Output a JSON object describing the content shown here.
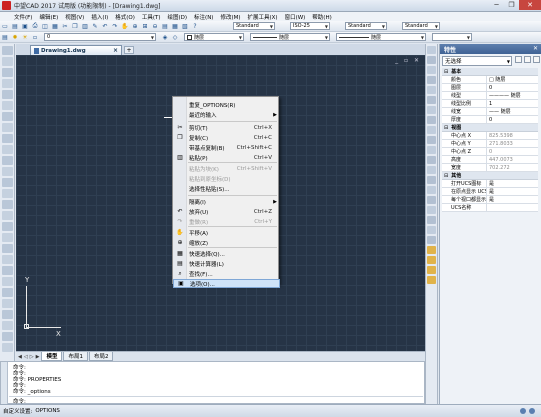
{
  "window": {
    "title": "中望CAD 2017 试用版 (功能限制) - [Drawing1.dwg]",
    "controls": [
      "─",
      "❐",
      "✕"
    ]
  },
  "menubar": [
    "文件(F)",
    "编辑(E)",
    "视图(V)",
    "插入(I)",
    "格式(O)",
    "工具(T)",
    "绘图(D)",
    "标注(N)",
    "修改(M)",
    "扩展工具(X)",
    "窗口(W)",
    "帮助(H)"
  ],
  "toolbar": {
    "textstyle": "Standard",
    "dimstyle": "ISO-25",
    "tablestyle": "Standard",
    "mleaderstyle": "Standard",
    "layer": "0",
    "color": "随层",
    "linetype": "随层",
    "lineweight": "随层"
  },
  "drawing": {
    "tab_label": "Drawing1.dwg",
    "ucs_x": "X",
    "ucs_y": "Y",
    "canvas_controls": "_ ▫ ✕"
  },
  "layout_tabs": [
    "模型",
    "布局1",
    "布局2"
  ],
  "context_menu": {
    "items": [
      {
        "label": "重复_OPTIONS(R)",
        "shortcut": "",
        "submenu": false,
        "disabled": false,
        "icon": ""
      },
      {
        "label": "最近的输入",
        "shortcut": "",
        "submenu": true,
        "disabled": false,
        "icon": ""
      },
      {
        "label": "剪切(T)",
        "shortcut": "Ctrl+X",
        "submenu": false,
        "disabled": false,
        "icon": "scissors-icon"
      },
      {
        "label": "复制(C)",
        "shortcut": "Ctrl+C",
        "submenu": false,
        "disabled": false,
        "icon": "copy-icon"
      },
      {
        "label": "带基点复制(B)",
        "shortcut": "Ctrl+Shift+C",
        "submenu": false,
        "disabled": false,
        "icon": ""
      },
      {
        "label": "粘贴(P)",
        "shortcut": "Ctrl+V",
        "submenu": false,
        "disabled": false,
        "icon": "paste-icon"
      },
      {
        "label": "粘贴为块(K)",
        "shortcut": "Ctrl+Shift+V",
        "submenu": false,
        "disabled": true,
        "icon": ""
      },
      {
        "label": "粘贴到原坐标(D)",
        "shortcut": "",
        "submenu": false,
        "disabled": true,
        "icon": ""
      },
      {
        "label": "选择性粘贴(S)...",
        "shortcut": "",
        "submenu": false,
        "disabled": false,
        "icon": ""
      },
      {
        "label": "隔离(I)",
        "shortcut": "",
        "submenu": true,
        "disabled": false,
        "icon": ""
      },
      {
        "label": "放弃(U)",
        "shortcut": "Ctrl+Z",
        "submenu": false,
        "disabled": false,
        "icon": "undo-icon"
      },
      {
        "label": "重做(R)",
        "shortcut": "Ctrl+Y",
        "submenu": false,
        "disabled": true,
        "icon": "redo-icon"
      },
      {
        "label": "平移(A)",
        "shortcut": "",
        "submenu": false,
        "disabled": false,
        "icon": "pan-icon"
      },
      {
        "label": "缩放(Z)",
        "shortcut": "",
        "submenu": false,
        "disabled": false,
        "icon": "zoom-icon"
      },
      {
        "label": "快速选择(Q)...",
        "shortcut": "",
        "submenu": false,
        "disabled": false,
        "icon": "quick-select-icon"
      },
      {
        "label": "快速计算器(L)",
        "shortcut": "",
        "submenu": false,
        "disabled": false,
        "icon": "calculator-icon"
      },
      {
        "label": "查找(F)...",
        "shortcut": "",
        "submenu": false,
        "disabled": false,
        "icon": "find-icon"
      },
      {
        "label": "选项(O)...",
        "shortcut": "",
        "submenu": false,
        "disabled": false,
        "icon": "options-icon"
      }
    ]
  },
  "command": {
    "history": [
      "命令:",
      "命令:",
      "命令: PROPERTIES",
      "命令:",
      "命令: _options"
    ],
    "prompt": "命令:"
  },
  "status": {
    "current_setting_label": "自定义设置:",
    "current_setting_value": "OPTIONS"
  },
  "properties": {
    "title": "特性",
    "selection": "无选择",
    "categories": [
      {
        "name": "基本",
        "rows": [
          {
            "key": "颜色",
            "value": "□ 随层",
            "readonly": false
          },
          {
            "key": "图层",
            "value": "0",
            "readonly": false
          },
          {
            "key": "线型",
            "value": "———— 随层",
            "readonly": false
          },
          {
            "key": "线型比例",
            "value": "1",
            "readonly": false
          },
          {
            "key": "线宽",
            "value": "—— 随层",
            "readonly": false
          },
          {
            "key": "厚度",
            "value": "0",
            "readonly": false
          }
        ]
      },
      {
        "name": "视图",
        "rows": [
          {
            "key": "中心点 X",
            "value": "825.5398",
            "readonly": true
          },
          {
            "key": "中心点 Y",
            "value": "271.8033",
            "readonly": true
          },
          {
            "key": "中心点 Z",
            "value": "0",
            "readonly": true
          },
          {
            "key": "高度",
            "value": "447.0073",
            "readonly": true
          },
          {
            "key": "宽度",
            "value": "702.272",
            "readonly": true
          }
        ]
      },
      {
        "name": "其他",
        "rows": [
          {
            "key": "打开UCS图标",
            "value": "是",
            "readonly": false
          },
          {
            "key": "在原点显示 UCS ...",
            "value": "是",
            "readonly": false
          },
          {
            "key": "每个视口都显示 ...",
            "value": "是",
            "readonly": false
          },
          {
            "key": "UCS名称",
            "value": "",
            "readonly": false
          }
        ]
      }
    ]
  }
}
